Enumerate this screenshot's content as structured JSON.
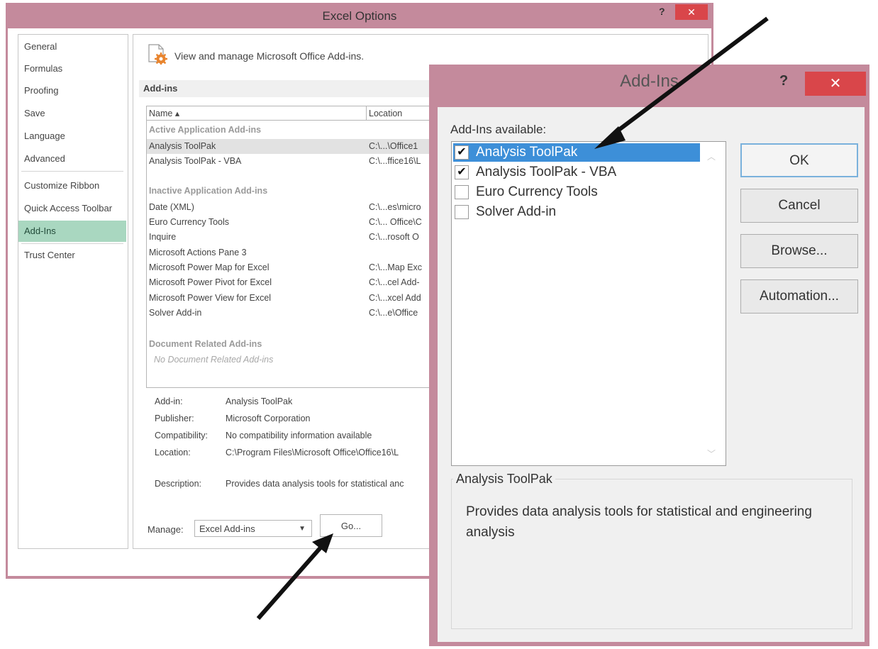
{
  "excel_options": {
    "title": "Excel Options",
    "help": "?",
    "close": "✕",
    "nav": [
      "General",
      "Formulas",
      "Proofing",
      "Save",
      "Language",
      "Advanced",
      "Customize Ribbon",
      "Quick Access Toolbar",
      "Add-Ins",
      "Trust Center"
    ],
    "header_text": "View and manage Microsoft Office Add-ins.",
    "section_title": "Add-ins",
    "columns": {
      "name": "Name ▴",
      "location": "Location"
    },
    "groups": {
      "active": "Active Application Add-ins",
      "inactive": "Inactive Application Add-ins",
      "document": "Document Related Add-ins"
    },
    "active_rows": [
      {
        "name": "Analysis ToolPak",
        "location": "C:\\...\\Office1"
      },
      {
        "name": "Analysis ToolPak - VBA",
        "location": "C:\\...ffice16\\L"
      }
    ],
    "inactive_rows": [
      {
        "name": "Date (XML)",
        "location": "C:\\...es\\micro"
      },
      {
        "name": "Euro Currency Tools",
        "location": "C:\\... Office\\C"
      },
      {
        "name": "Inquire",
        "location": "C:\\...rosoft O"
      },
      {
        "name": "Microsoft Actions Pane 3",
        "location": ""
      },
      {
        "name": "Microsoft Power Map for Excel",
        "location": "C:\\...Map Exc"
      },
      {
        "name": "Microsoft Power Pivot for Excel",
        "location": "C:\\...cel Add-"
      },
      {
        "name": "Microsoft Power View for Excel",
        "location": "C:\\...xcel Add"
      },
      {
        "name": "Solver Add-in",
        "location": "C:\\...e\\Office"
      }
    ],
    "no_document": "No Document Related Add-ins",
    "details": [
      {
        "label": "Add-in:",
        "value": "Analysis ToolPak"
      },
      {
        "label": "Publisher:",
        "value": "Microsoft Corporation"
      },
      {
        "label": "Compatibility:",
        "value": "No compatibility information available"
      },
      {
        "label": "Location:",
        "value": "C:\\Program Files\\Microsoft Office\\Office16\\L"
      },
      {
        "label": "Description:",
        "value": "Provides data analysis tools for statistical anc"
      }
    ],
    "manage_label": "Manage:",
    "manage_value": "Excel Add-ins",
    "go_button": "Go..."
  },
  "addins_dialog": {
    "title": "Add-Ins",
    "help": "?",
    "close": "✕",
    "available_label": "Add-Ins available:",
    "items": [
      {
        "label": "Analysis ToolPak",
        "checked": true,
        "selected": true
      },
      {
        "label": "Analysis ToolPak - VBA",
        "checked": true,
        "selected": false
      },
      {
        "label": "Euro Currency Tools",
        "checked": false,
        "selected": false
      },
      {
        "label": "Solver Add-in",
        "checked": false,
        "selected": false
      }
    ],
    "buttons": {
      "ok": "OK",
      "cancel": "Cancel",
      "browse": "Browse...",
      "automation": "Automation..."
    },
    "group_title": "Analysis ToolPak",
    "description": "Provides data analysis tools for statistical and engineering analysis"
  }
}
